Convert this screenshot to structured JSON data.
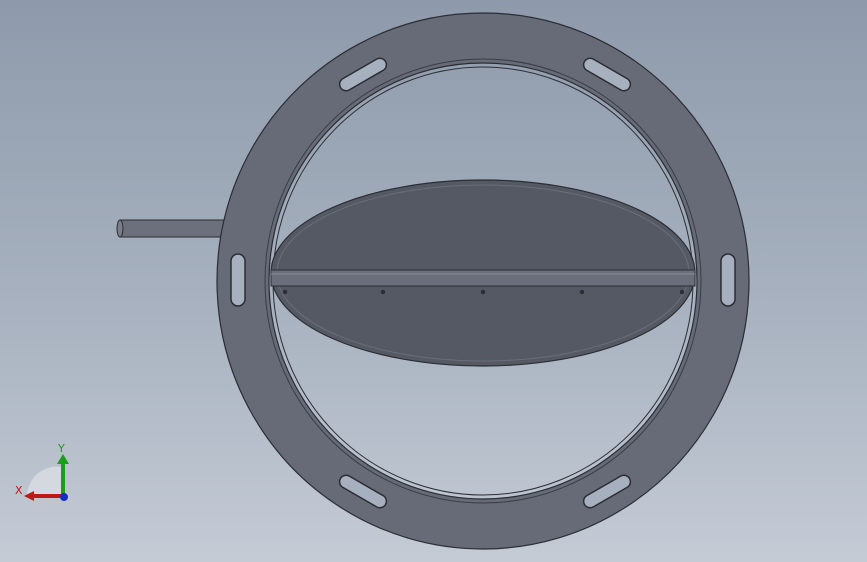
{
  "viewport": {
    "background_top": "#8e9aab",
    "background_bottom": "#c4cbd5"
  },
  "model": {
    "part_color": "#676b78",
    "edge_color": "#2b2d33",
    "disc_color": "#555964",
    "interior_color": "#9ba5b4"
  },
  "triad": {
    "x_label": "X",
    "y_label": "Y",
    "x_color": "#c01818",
    "y_color": "#18a018",
    "z_color": "#1a2cc0"
  }
}
